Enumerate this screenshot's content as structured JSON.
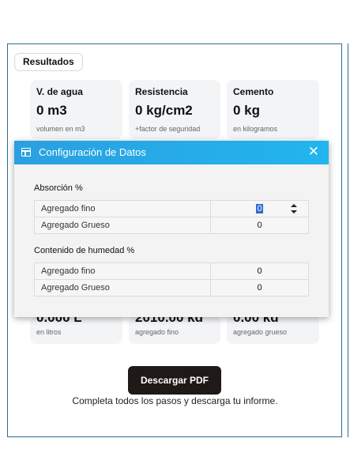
{
  "results_tag": "Resultados",
  "cards_top": [
    {
      "label": "V. de agua",
      "value": "0 m3",
      "sub": "volumen en m3"
    },
    {
      "label": "Resistencia",
      "value": "0 kg/cm2",
      "sub": "+factor de seguridad"
    },
    {
      "label": "Cemento",
      "value": "0 kg",
      "sub": "en kilogramos"
    }
  ],
  "cards_bottom": [
    {
      "value_partial": "0.000 L",
      "sub": "en litros"
    },
    {
      "value_partial": "2010.00 kg",
      "sub": "agregado fino"
    },
    {
      "value_partial": "0.00 kg",
      "sub": "agregado grueso"
    }
  ],
  "pdf_button": "Descargar PDF",
  "footer_text": "Completa todos los pasos y descarga tu informe.",
  "modal": {
    "title": "Configuración de Datos",
    "close": "✕",
    "absorption": {
      "label": "Absorción %",
      "rows": [
        {
          "name": "Agregado fino",
          "value": "0"
        },
        {
          "name": "Agregado Grueso",
          "value": "0"
        }
      ]
    },
    "humidity": {
      "label": "Contenido de humedad %",
      "rows": [
        {
          "name": "Agregado fino",
          "value": "0"
        },
        {
          "name": "Agregado Grueso",
          "value": "0"
        }
      ]
    }
  },
  "colors": {
    "modal_header": "#22b5ee",
    "pdf_button": "#1f1a17",
    "card_bg": "#f3f4f6",
    "panel_border": "#2a6f94"
  }
}
